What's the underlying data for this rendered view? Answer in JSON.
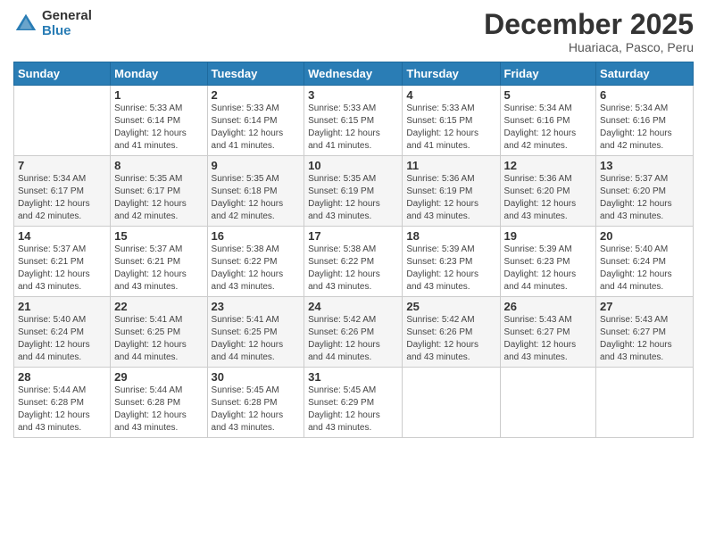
{
  "logo": {
    "general": "General",
    "blue": "Blue"
  },
  "title": "December 2025",
  "subtitle": "Huariaca, Pasco, Peru",
  "days_header": [
    "Sunday",
    "Monday",
    "Tuesday",
    "Wednesday",
    "Thursday",
    "Friday",
    "Saturday"
  ],
  "weeks": [
    [
      {
        "day": "",
        "info": ""
      },
      {
        "day": "1",
        "info": "Sunrise: 5:33 AM\nSunset: 6:14 PM\nDaylight: 12 hours\nand 41 minutes."
      },
      {
        "day": "2",
        "info": "Sunrise: 5:33 AM\nSunset: 6:14 PM\nDaylight: 12 hours\nand 41 minutes."
      },
      {
        "day": "3",
        "info": "Sunrise: 5:33 AM\nSunset: 6:15 PM\nDaylight: 12 hours\nand 41 minutes."
      },
      {
        "day": "4",
        "info": "Sunrise: 5:33 AM\nSunset: 6:15 PM\nDaylight: 12 hours\nand 41 minutes."
      },
      {
        "day": "5",
        "info": "Sunrise: 5:34 AM\nSunset: 6:16 PM\nDaylight: 12 hours\nand 42 minutes."
      },
      {
        "day": "6",
        "info": "Sunrise: 5:34 AM\nSunset: 6:16 PM\nDaylight: 12 hours\nand 42 minutes."
      }
    ],
    [
      {
        "day": "7",
        "info": "Sunrise: 5:34 AM\nSunset: 6:17 PM\nDaylight: 12 hours\nand 42 minutes."
      },
      {
        "day": "8",
        "info": "Sunrise: 5:35 AM\nSunset: 6:17 PM\nDaylight: 12 hours\nand 42 minutes."
      },
      {
        "day": "9",
        "info": "Sunrise: 5:35 AM\nSunset: 6:18 PM\nDaylight: 12 hours\nand 42 minutes."
      },
      {
        "day": "10",
        "info": "Sunrise: 5:35 AM\nSunset: 6:19 PM\nDaylight: 12 hours\nand 43 minutes."
      },
      {
        "day": "11",
        "info": "Sunrise: 5:36 AM\nSunset: 6:19 PM\nDaylight: 12 hours\nand 43 minutes."
      },
      {
        "day": "12",
        "info": "Sunrise: 5:36 AM\nSunset: 6:20 PM\nDaylight: 12 hours\nand 43 minutes."
      },
      {
        "day": "13",
        "info": "Sunrise: 5:37 AM\nSunset: 6:20 PM\nDaylight: 12 hours\nand 43 minutes."
      }
    ],
    [
      {
        "day": "14",
        "info": "Sunrise: 5:37 AM\nSunset: 6:21 PM\nDaylight: 12 hours\nand 43 minutes."
      },
      {
        "day": "15",
        "info": "Sunrise: 5:37 AM\nSunset: 6:21 PM\nDaylight: 12 hours\nand 43 minutes."
      },
      {
        "day": "16",
        "info": "Sunrise: 5:38 AM\nSunset: 6:22 PM\nDaylight: 12 hours\nand 43 minutes."
      },
      {
        "day": "17",
        "info": "Sunrise: 5:38 AM\nSunset: 6:22 PM\nDaylight: 12 hours\nand 43 minutes."
      },
      {
        "day": "18",
        "info": "Sunrise: 5:39 AM\nSunset: 6:23 PM\nDaylight: 12 hours\nand 43 minutes."
      },
      {
        "day": "19",
        "info": "Sunrise: 5:39 AM\nSunset: 6:23 PM\nDaylight: 12 hours\nand 44 minutes."
      },
      {
        "day": "20",
        "info": "Sunrise: 5:40 AM\nSunset: 6:24 PM\nDaylight: 12 hours\nand 44 minutes."
      }
    ],
    [
      {
        "day": "21",
        "info": "Sunrise: 5:40 AM\nSunset: 6:24 PM\nDaylight: 12 hours\nand 44 minutes."
      },
      {
        "day": "22",
        "info": "Sunrise: 5:41 AM\nSunset: 6:25 PM\nDaylight: 12 hours\nand 44 minutes."
      },
      {
        "day": "23",
        "info": "Sunrise: 5:41 AM\nSunset: 6:25 PM\nDaylight: 12 hours\nand 44 minutes."
      },
      {
        "day": "24",
        "info": "Sunrise: 5:42 AM\nSunset: 6:26 PM\nDaylight: 12 hours\nand 44 minutes."
      },
      {
        "day": "25",
        "info": "Sunrise: 5:42 AM\nSunset: 6:26 PM\nDaylight: 12 hours\nand 43 minutes."
      },
      {
        "day": "26",
        "info": "Sunrise: 5:43 AM\nSunset: 6:27 PM\nDaylight: 12 hours\nand 43 minutes."
      },
      {
        "day": "27",
        "info": "Sunrise: 5:43 AM\nSunset: 6:27 PM\nDaylight: 12 hours\nand 43 minutes."
      }
    ],
    [
      {
        "day": "28",
        "info": "Sunrise: 5:44 AM\nSunset: 6:28 PM\nDaylight: 12 hours\nand 43 minutes."
      },
      {
        "day": "29",
        "info": "Sunrise: 5:44 AM\nSunset: 6:28 PM\nDaylight: 12 hours\nand 43 minutes."
      },
      {
        "day": "30",
        "info": "Sunrise: 5:45 AM\nSunset: 6:28 PM\nDaylight: 12 hours\nand 43 minutes."
      },
      {
        "day": "31",
        "info": "Sunrise: 5:45 AM\nSunset: 6:29 PM\nDaylight: 12 hours\nand 43 minutes."
      },
      {
        "day": "",
        "info": ""
      },
      {
        "day": "",
        "info": ""
      },
      {
        "day": "",
        "info": ""
      }
    ]
  ]
}
